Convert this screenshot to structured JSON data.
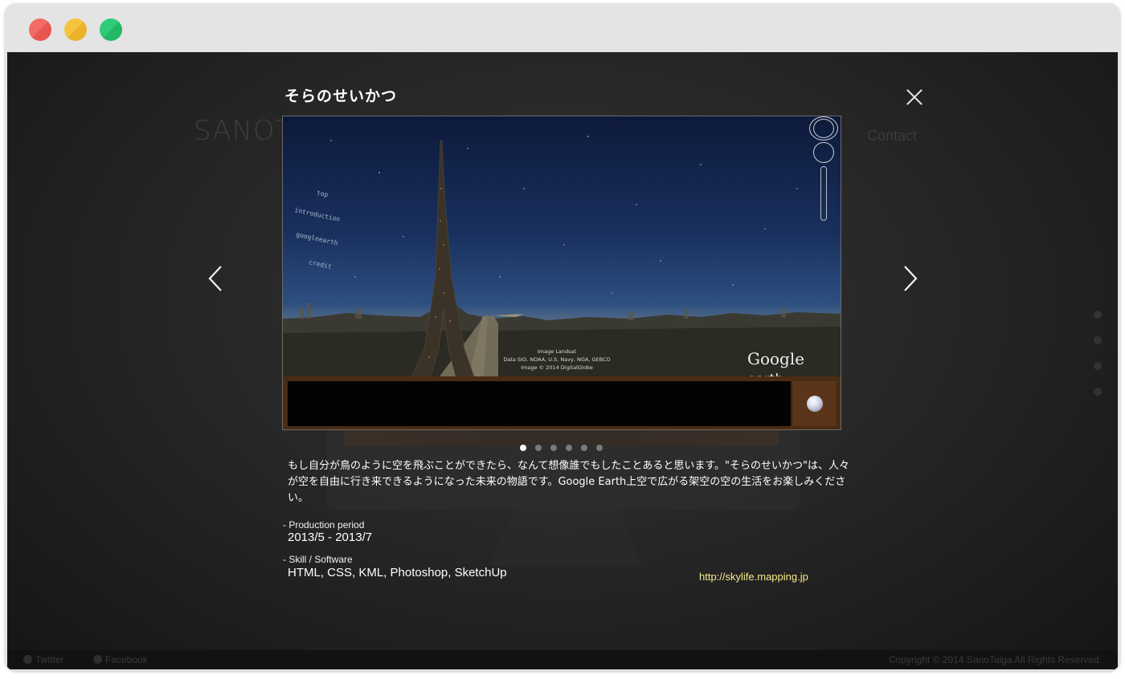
{
  "window": {
    "controls": [
      "close",
      "minimize",
      "maximize"
    ]
  },
  "background": {
    "logo": "SANOT",
    "nav_contact": "Contact",
    "footer": {
      "twitter": "Twitter",
      "facebook": "Facebook",
      "copyright": "Copyright © 2014 SanoTaiga All Rights Reserved."
    }
  },
  "modal": {
    "title": "そらのせいかつ",
    "slide": {
      "menu": [
        "top",
        "introduction",
        "googleearth",
        "credit"
      ],
      "credit_lines": [
        "Image Landsat",
        "Data SIO, NOAA, U.S. Navy, NGA, GEBCO",
        "Image © 2014 DigitalGlobe"
      ],
      "logo_main": "Google",
      "logo_sub": " earth"
    },
    "pager": {
      "count": 6,
      "active": 0
    },
    "description": "もし自分が鳥のように空を飛ぶことができたら、なんて想像誰でもしたことあると思います。\"そらのせいかつ\"は、人々が空を自由に行き来できるようになった未来の物語です。Google Earth上空で広がる架空の空の生活をお楽しみください。",
    "production_label": "- Production period",
    "production_value": "2013/5 - 2013/7",
    "skill_label": "- Skill / Software",
    "skill_value": "HTML, CSS, KML, Photoshop, SketchUp",
    "link": "http://skylife.mapping.jp"
  },
  "colors": {
    "link": "#f5ec8a",
    "control_bar": "#4a2c14"
  }
}
